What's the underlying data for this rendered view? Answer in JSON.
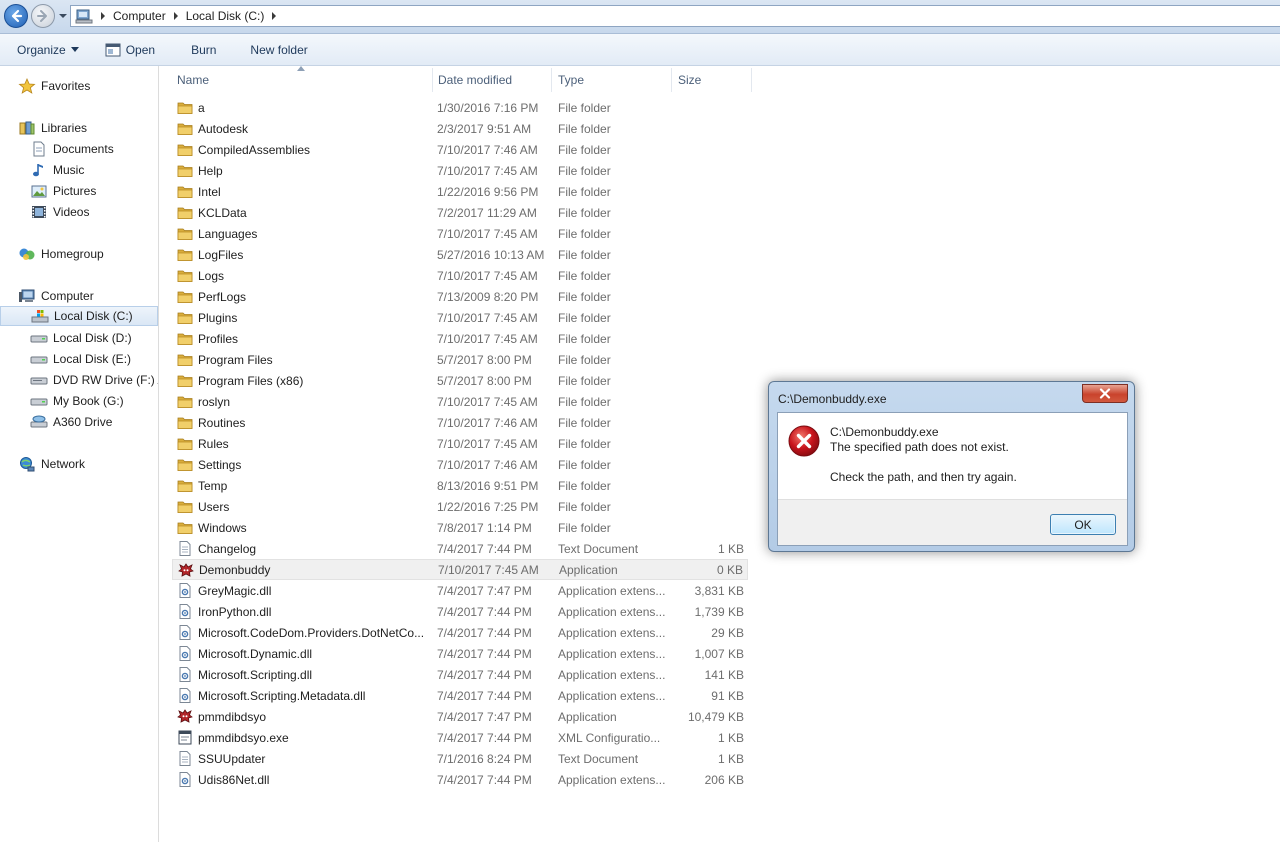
{
  "address_bar": {
    "crumbs": [
      "Computer",
      "Local Disk (C:)"
    ]
  },
  "toolbar": {
    "organize_label": "Organize",
    "open_label": "Open",
    "burn_label": "Burn",
    "new_folder_label": "New folder"
  },
  "navpane": {
    "favorites": "Favorites",
    "libraries": "Libraries",
    "documents": "Documents",
    "music": "Music",
    "pictures": "Pictures",
    "videos": "Videos",
    "homegroup": "Homegroup",
    "computer": "Computer",
    "drive_c": "Local Disk (C:)",
    "drive_d": "Local Disk (D:)",
    "drive_e": "Local Disk (E:)",
    "drive_f": "DVD RW Drive (F:) A",
    "drive_g": "My Book (G:)",
    "a360": "A360 Drive",
    "network": "Network"
  },
  "columns": {
    "name": "Name",
    "date": "Date modified",
    "type": "Type",
    "size": "Size"
  },
  "files": [
    {
      "name": "a",
      "date": "1/30/2016 7:16 PM",
      "type": "File folder",
      "size": "",
      "icon": "folder-icon"
    },
    {
      "name": "Autodesk",
      "date": "2/3/2017 9:51 AM",
      "type": "File folder",
      "size": "",
      "icon": "folder-icon"
    },
    {
      "name": "CompiledAssemblies",
      "date": "7/10/2017 7:46 AM",
      "type": "File folder",
      "size": "",
      "icon": "folder-icon"
    },
    {
      "name": "Help",
      "date": "7/10/2017 7:45 AM",
      "type": "File folder",
      "size": "",
      "icon": "folder-icon"
    },
    {
      "name": "Intel",
      "date": "1/22/2016 9:56 PM",
      "type": "File folder",
      "size": "",
      "icon": "folder-icon"
    },
    {
      "name": "KCLData",
      "date": "7/2/2017 11:29 AM",
      "type": "File folder",
      "size": "",
      "icon": "folder-icon"
    },
    {
      "name": "Languages",
      "date": "7/10/2017 7:45 AM",
      "type": "File folder",
      "size": "",
      "icon": "folder-icon"
    },
    {
      "name": "LogFiles",
      "date": "5/27/2016 10:13 AM",
      "type": "File folder",
      "size": "",
      "icon": "folder-icon"
    },
    {
      "name": "Logs",
      "date": "7/10/2017 7:45 AM",
      "type": "File folder",
      "size": "",
      "icon": "folder-icon"
    },
    {
      "name": "PerfLogs",
      "date": "7/13/2009 8:20 PM",
      "type": "File folder",
      "size": "",
      "icon": "folder-icon"
    },
    {
      "name": "Plugins",
      "date": "7/10/2017 7:45 AM",
      "type": "File folder",
      "size": "",
      "icon": "folder-icon"
    },
    {
      "name": "Profiles",
      "date": "7/10/2017 7:45 AM",
      "type": "File folder",
      "size": "",
      "icon": "folder-icon"
    },
    {
      "name": "Program Files",
      "date": "5/7/2017 8:00 PM",
      "type": "File folder",
      "size": "",
      "icon": "folder-icon"
    },
    {
      "name": "Program Files (x86)",
      "date": "5/7/2017 8:00 PM",
      "type": "File folder",
      "size": "",
      "icon": "folder-icon"
    },
    {
      "name": "roslyn",
      "date": "7/10/2017 7:45 AM",
      "type": "File folder",
      "size": "",
      "icon": "folder-icon"
    },
    {
      "name": "Routines",
      "date": "7/10/2017 7:46 AM",
      "type": "File folder",
      "size": "",
      "icon": "folder-icon"
    },
    {
      "name": "Rules",
      "date": "7/10/2017 7:45 AM",
      "type": "File folder",
      "size": "",
      "icon": "folder-icon"
    },
    {
      "name": "Settings",
      "date": "7/10/2017 7:46 AM",
      "type": "File folder",
      "size": "",
      "icon": "folder-icon"
    },
    {
      "name": "Temp",
      "date": "8/13/2016 9:51 PM",
      "type": "File folder",
      "size": "",
      "icon": "folder-icon"
    },
    {
      "name": "Users",
      "date": "1/22/2016 7:25 PM",
      "type": "File folder",
      "size": "",
      "icon": "folder-icon"
    },
    {
      "name": "Windows",
      "date": "7/8/2017 1:14 PM",
      "type": "File folder",
      "size": "",
      "icon": "folder-icon"
    },
    {
      "name": "Changelog",
      "date": "7/4/2017 7:44 PM",
      "type": "Text Document",
      "size": "1 KB",
      "icon": "text-document-icon"
    },
    {
      "name": "Demonbuddy",
      "date": "7/10/2017 7:45 AM",
      "type": "Application",
      "size": "0 KB",
      "icon": "demonbuddy-app-icon"
    },
    {
      "name": "GreyMagic.dll",
      "date": "7/4/2017 7:47 PM",
      "type": "Application extens...",
      "size": "3,831 KB",
      "icon": "dll-file-icon"
    },
    {
      "name": "IronPython.dll",
      "date": "7/4/2017 7:44 PM",
      "type": "Application extens...",
      "size": "1,739 KB",
      "icon": "dll-file-icon"
    },
    {
      "name": "Microsoft.CodeDom.Providers.DotNetCo...",
      "date": "7/4/2017 7:44 PM",
      "type": "Application extens...",
      "size": "29 KB",
      "icon": "dll-file-icon"
    },
    {
      "name": "Microsoft.Dynamic.dll",
      "date": "7/4/2017 7:44 PM",
      "type": "Application extens...",
      "size": "1,007 KB",
      "icon": "dll-file-icon"
    },
    {
      "name": "Microsoft.Scripting.dll",
      "date": "7/4/2017 7:44 PM",
      "type": "Application extens...",
      "size": "141 KB",
      "icon": "dll-file-icon"
    },
    {
      "name": "Microsoft.Scripting.Metadata.dll",
      "date": "7/4/2017 7:44 PM",
      "type": "Application extens...",
      "size": "91 KB",
      "icon": "dll-file-icon"
    },
    {
      "name": "pmmdibdsyo",
      "date": "7/4/2017 7:47 PM",
      "type": "Application",
      "size": "10,479 KB",
      "icon": "demonbuddy-app-icon"
    },
    {
      "name": "pmmdibdsyo.exe",
      "date": "7/4/2017 7:44 PM",
      "type": "XML Configuratio...",
      "size": "1 KB",
      "icon": "config-file-icon"
    },
    {
      "name": "SSUUpdater",
      "date": "7/1/2016 8:24 PM",
      "type": "Text Document",
      "size": "1 KB",
      "icon": "text-document-icon"
    },
    {
      "name": "Udis86Net.dll",
      "date": "7/4/2017 7:44 PM",
      "type": "Application extens...",
      "size": "206 KB",
      "icon": "dll-file-icon"
    }
  ],
  "dialog": {
    "title": "C:\\Demonbuddy.exe",
    "line1": "C:\\Demonbuddy.exe",
    "line2": "The specified path does not exist.",
    "line3": "Check the path, and then try again.",
    "ok_label": "OK"
  },
  "colors": {
    "folder": "#e8c25a",
    "error_red": "#c8141c",
    "selection": "#dae7f5"
  }
}
